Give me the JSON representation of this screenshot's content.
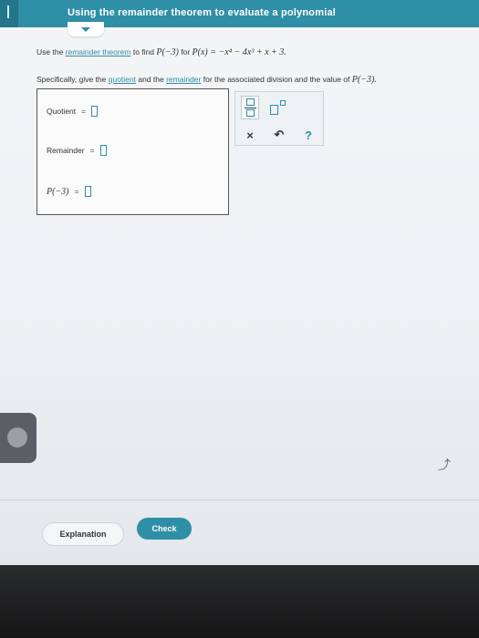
{
  "header": {
    "title": "Using the remainder theorem to evaluate a polynomial"
  },
  "problem": {
    "line1_prefix": "Use the ",
    "line1_link": "remainder theorem",
    "line1_mid": " to find ",
    "line1_target": "P(−3)",
    "line1_for": " for ",
    "polynomial": "P(x) = −x⁴ − 4x³ + x + 3.",
    "line2_prefix": "Specifically, give the ",
    "line2_link1": "quotient",
    "line2_mid": " and the ",
    "line2_link2": "remainder",
    "line2_suffix": " for the associated division and the value of ",
    "line2_target": "P(−3)."
  },
  "answers": {
    "quotient_label": "Quotient",
    "remainder_label": "Remainder",
    "p_label": "P(−3)",
    "equals": "="
  },
  "toolbox": {
    "times": "×",
    "undo": "↶",
    "help": "?"
  },
  "buttons": {
    "explanation": "Explanation",
    "check": "Check"
  },
  "colors": {
    "accent": "#2f8fa6",
    "header": "#2f8fa6"
  }
}
